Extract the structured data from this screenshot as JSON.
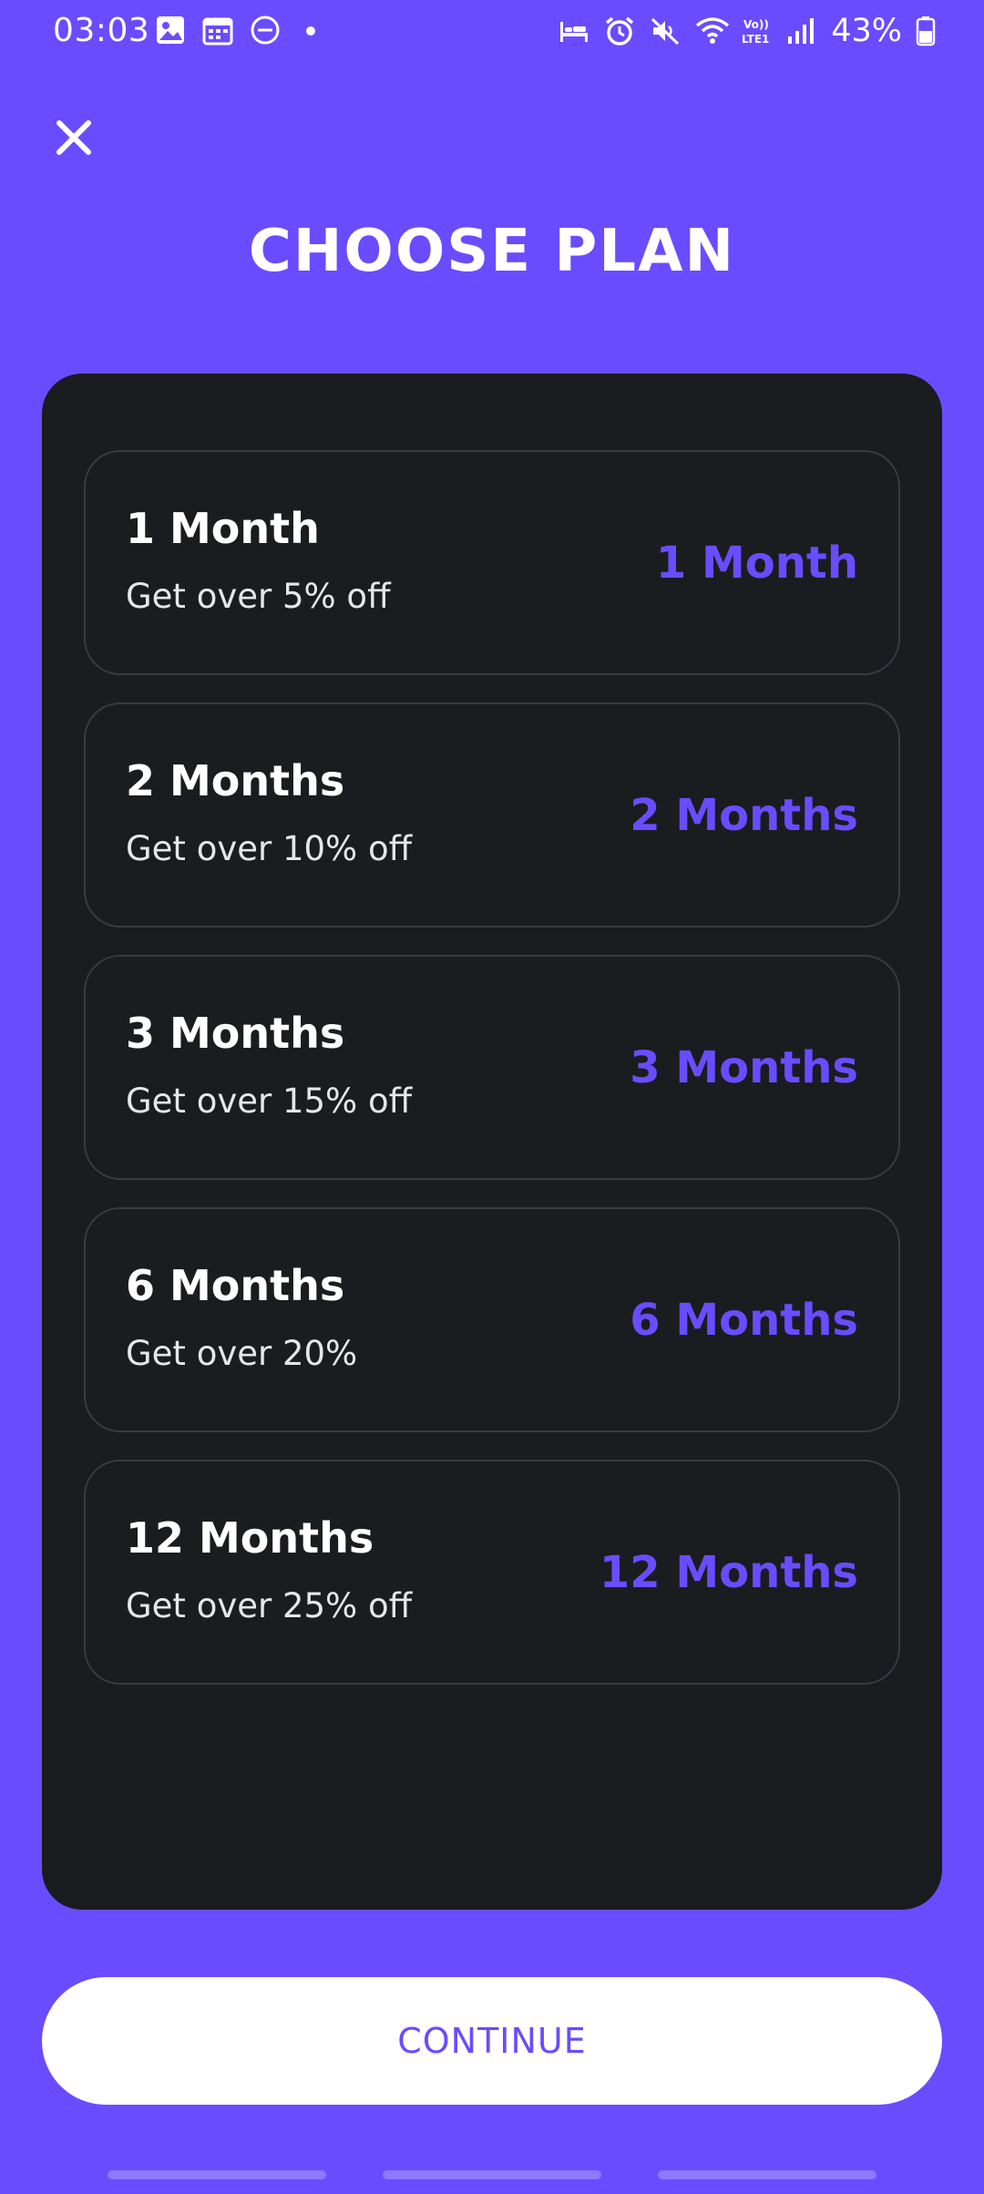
{
  "status_bar": {
    "time": "03:03",
    "battery_percent": "43%",
    "left_icons": [
      "gallery-icon",
      "calendar-icon",
      "dnd-icon",
      "notification-dot"
    ],
    "right_icons": [
      "bed-icon",
      "alarm-icon",
      "mute-icon",
      "wifi-icon",
      "volte-icon",
      "signal-icon",
      "battery-icon"
    ],
    "volte_text": "Vo))\nLTE1"
  },
  "header": {
    "title": "CHOOSE PLAN"
  },
  "plans": [
    {
      "name": "1 Month",
      "description": "Get over 5% off",
      "price": "1 Month"
    },
    {
      "name": "2 Months",
      "description": "Get over 10% off",
      "price": "2 Months"
    },
    {
      "name": "3 Months",
      "description": "Get over 15% off",
      "price": "3 Months"
    },
    {
      "name": "6 Months",
      "description": "Get over 20%",
      "price": "6 Months"
    },
    {
      "name": "12 Months",
      "description": "Get over 25% off",
      "price": "12 Months"
    }
  ],
  "continue_button": {
    "label": "CONTINUE"
  },
  "colors": {
    "background": "#6A4CFF",
    "panel": "#1B1C20",
    "accent": "#6A4CFF",
    "button": "#FFFFFF"
  }
}
